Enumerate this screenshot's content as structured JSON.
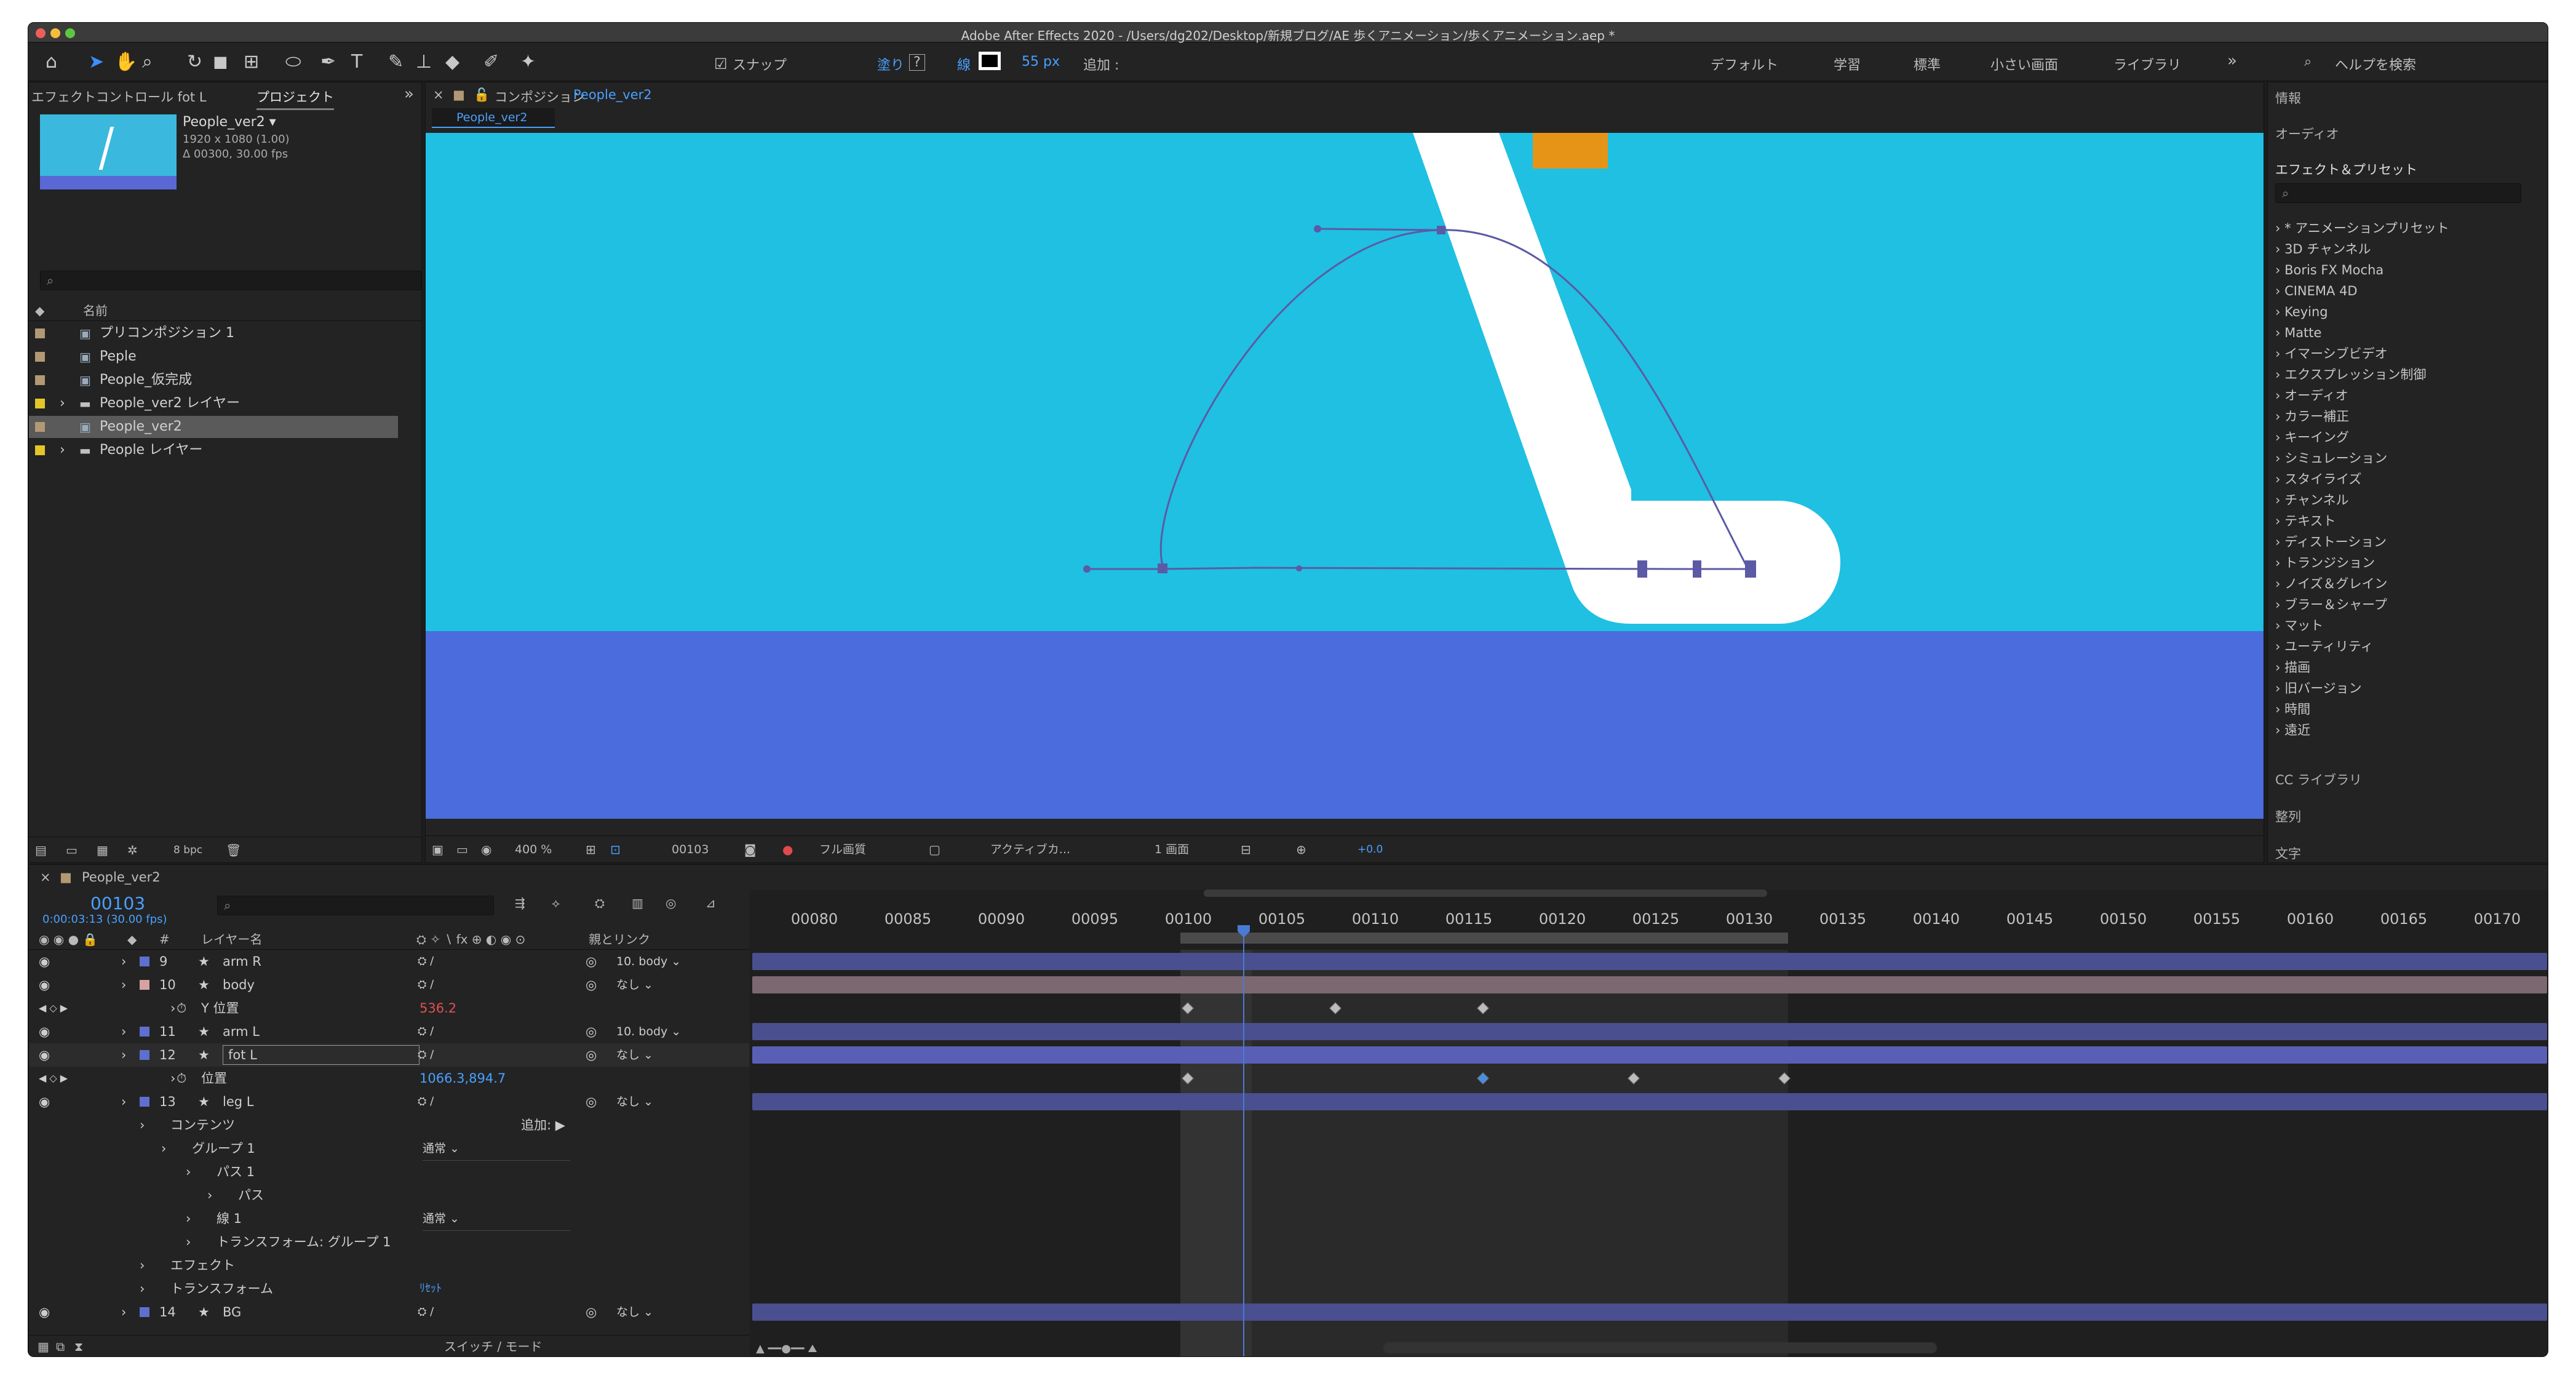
{
  "app": {
    "title": "Adobe After Effects 2020 - /Users/dg202/Desktop/新規ブログ/AE 歩くアニメーション/歩くアニメーション.aep *"
  },
  "toolbar": {
    "snap_label": "スナップ",
    "fill_label": "塗り",
    "fill_value": "?",
    "stroke_label": "線",
    "stroke_px": "55 px",
    "add_label": "追加 :",
    "workspaces": [
      "デフォルト",
      "学習",
      "標準",
      "小さい画面",
      "ライブラリ"
    ],
    "help_search_placeholder": "ヘルプを検索"
  },
  "project_panel": {
    "tabs": [
      "エフェクトコントロール fot L",
      "プロジェクト"
    ],
    "selected_item": {
      "name": "People_ver2 ▾",
      "size": "1920 x 1080 (1.00)",
      "duration": "Δ 00300, 30.00 fps"
    },
    "column_name": "名前",
    "items": [
      {
        "name": "プリコンポジション 1",
        "color": "#b29874",
        "type": "comp"
      },
      {
        "name": "Peple",
        "color": "#b29874",
        "type": "comp"
      },
      {
        "name": "People_仮完成",
        "color": "#b29874",
        "type": "comp"
      },
      {
        "name": "People_ver2 レイヤー",
        "color": "#e3c52a",
        "type": "folder"
      },
      {
        "name": "People_ver2",
        "color": "#b29874",
        "type": "comp"
      },
      {
        "name": "People レイヤー",
        "color": "#e3c52a",
        "type": "folder"
      }
    ],
    "bpc": "8 bpc"
  },
  "comp_panel": {
    "header": "コンポジション",
    "comp_name": "People_ver2",
    "tab": "People_ver2",
    "zoom": "400 %",
    "frame": "00103",
    "quality": "フル画質",
    "camera": "アクティブカ...",
    "views": "1 画面",
    "exposure": "+0.0"
  },
  "right_panel": {
    "info": "情報",
    "audio": "オーディオ",
    "effects_title": "エフェクト＆プリセット",
    "effects": [
      "* アニメーションプリセット",
      "3D チャンネル",
      "Boris FX Mocha",
      "CINEMA 4D",
      "Keying",
      "Matte",
      "イマーシブビデオ",
      "エクスプレッション制御",
      "オーディオ",
      "カラー補正",
      "キーイング",
      "シミュレーション",
      "スタイライズ",
      "チャンネル",
      "テキスト",
      "ディストーション",
      "トランジション",
      "ノイズ＆グレイン",
      "ブラー＆シャープ",
      "マット",
      "ユーティリティ",
      "描画",
      "旧バージョン",
      "時間",
      "遠近"
    ],
    "cc_library": "CC ライブラリ",
    "align": "整列",
    "text": "文字"
  },
  "timeline": {
    "tab": "People_ver2",
    "current_frame": "00103",
    "current_time": "0:00:03:13 (30.00 fps)",
    "col_layer_name": "レイヤー名",
    "col_parent": "親とリンク",
    "ruler": [
      "00080",
      "00085",
      "00090",
      "00095",
      "00100",
      "00105",
      "00110",
      "00115",
      "00120",
      "00125",
      "00130",
      "00135",
      "00140",
      "00145",
      "00150",
      "00155",
      "00160",
      "00165",
      "00170"
    ],
    "rows": [
      {
        "num": "9",
        "name": "arm R",
        "parent": "10. body",
        "color": "#5f6fcf",
        "bar": "#4a4f8f"
      },
      {
        "num": "10",
        "name": "body",
        "parent": "なし",
        "color": "#d6a3a3",
        "bar": "#7b6870"
      },
      {
        "num": "",
        "name": "Y 位置",
        "value": "536.2",
        "prop": true
      },
      {
        "num": "11",
        "name": "arm L",
        "parent": "10. body",
        "color": "#5f6fcf",
        "bar": "#4a4f8f"
      },
      {
        "num": "12",
        "name": "fot L",
        "parent": "なし",
        "color": "#5f6fcf",
        "bar": "#5a5fb6"
      },
      {
        "num": "",
        "name": "位置",
        "value": "1066.3,894.7",
        "prop": true
      },
      {
        "num": "13",
        "name": "leg L",
        "parent": "なし",
        "color": "#5f6fcf",
        "bar": "#4a4f8f"
      },
      {
        "num": "",
        "name": "コンテンツ",
        "add": "追加:",
        "prop": true
      },
      {
        "num": "",
        "name": "グループ 1",
        "mode": "通常",
        "prop": true
      },
      {
        "num": "",
        "name": "パス 1",
        "prop": true
      },
      {
        "num": "",
        "name": "パス",
        "prop": true
      },
      {
        "num": "",
        "name": "線 1",
        "mode": "通常",
        "prop": true
      },
      {
        "num": "",
        "name": "トランスフォーム: グループ 1",
        "prop": true
      },
      {
        "num": "",
        "name": "エフェクト",
        "prop": true
      },
      {
        "num": "",
        "name": "トランスフォーム",
        "reset": "ﾘｾｯﾄ",
        "prop": true
      },
      {
        "num": "14",
        "name": "BG",
        "parent": "なし",
        "color": "#5f6fcf",
        "bar": "#4a4f8f"
      }
    ],
    "switch_mode": "スイッチ / モード"
  }
}
